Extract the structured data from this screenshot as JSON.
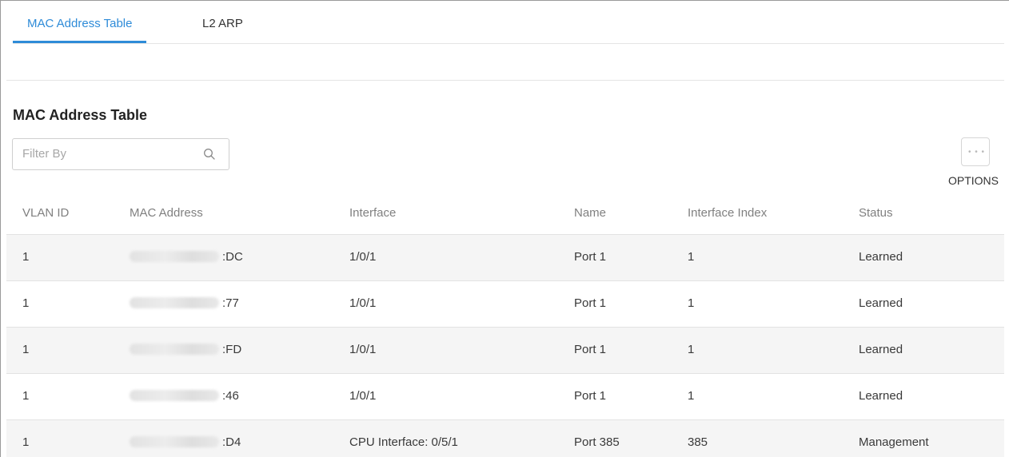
{
  "tabs": [
    {
      "label": "MAC Address Table",
      "active": true
    },
    {
      "label": "L2 ARP",
      "active": false
    }
  ],
  "section_title": "MAC Address Table",
  "filter": {
    "placeholder": "Filter By",
    "icon": "search-icon"
  },
  "options": {
    "label": "OPTIONS",
    "icon": "more-dots-icon"
  },
  "colors": {
    "accent": "#2e8bd8",
    "row_alt": "#f5f5f5",
    "header_text": "#808080"
  },
  "table": {
    "columns": [
      "VLAN ID",
      "MAC Address",
      "Interface",
      "Name",
      "Interface Index",
      "Status"
    ],
    "rows": [
      {
        "vlan": "1",
        "mac_suffix": ":DC",
        "interface": "1/0/1",
        "name": "Port 1",
        "index": "1",
        "status": "Learned"
      },
      {
        "vlan": "1",
        "mac_suffix": ":77",
        "interface": "1/0/1",
        "name": "Port 1",
        "index": "1",
        "status": "Learned"
      },
      {
        "vlan": "1",
        "mac_suffix": ":FD",
        "interface": "1/0/1",
        "name": "Port 1",
        "index": "1",
        "status": "Learned"
      },
      {
        "vlan": "1",
        "mac_suffix": ":46",
        "interface": "1/0/1",
        "name": "Port 1",
        "index": "1",
        "status": "Learned"
      },
      {
        "vlan": "1",
        "mac_suffix": ":D4",
        "interface": "CPU Interface: 0/5/1",
        "name": "Port 385",
        "index": "385",
        "status": "Management"
      }
    ]
  }
}
